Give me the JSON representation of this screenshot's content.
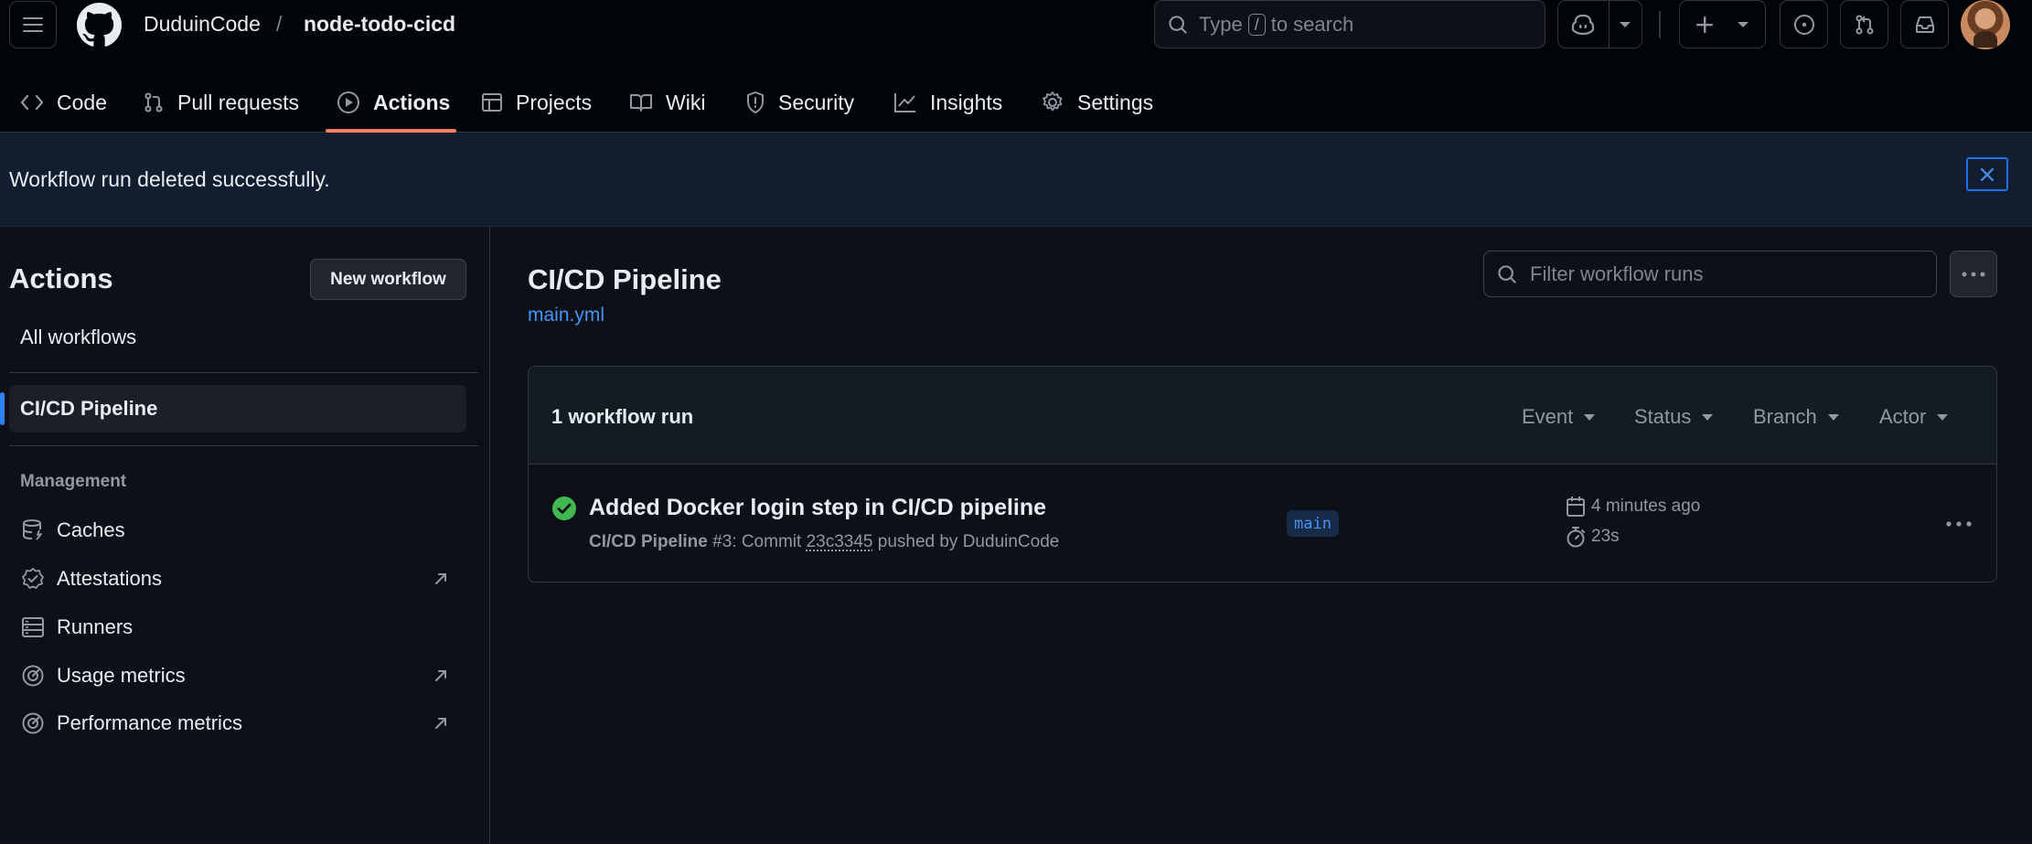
{
  "header": {
    "owner": "DuduinCode",
    "separator": "/",
    "repo": "node-todo-cicd",
    "search_prefix": "Type",
    "search_key": "/",
    "search_suffix": "to search"
  },
  "tabs": [
    {
      "label": "Code",
      "icon": "code-icon"
    },
    {
      "label": "Pull requests",
      "icon": "git-pull-request-icon"
    },
    {
      "label": "Actions",
      "icon": "play-icon",
      "active": true
    },
    {
      "label": "Projects",
      "icon": "table-icon"
    },
    {
      "label": "Wiki",
      "icon": "book-icon"
    },
    {
      "label": "Security",
      "icon": "shield-icon"
    },
    {
      "label": "Insights",
      "icon": "graph-icon"
    },
    {
      "label": "Settings",
      "icon": "gear-icon"
    }
  ],
  "flash": {
    "message": "Workflow run deleted successfully."
  },
  "sidebar": {
    "title": "Actions",
    "new_workflow": "New workflow",
    "all_workflows": "All workflows",
    "selected_workflow": "CI/CD Pipeline",
    "management_heading": "Management",
    "items": [
      {
        "label": "Caches",
        "icon": "database-icon",
        "external": false
      },
      {
        "label": "Attestations",
        "icon": "verified-icon",
        "external": true
      },
      {
        "label": "Runners",
        "icon": "server-icon",
        "external": false
      },
      {
        "label": "Usage metrics",
        "icon": "meter-icon",
        "external": true
      },
      {
        "label": "Performance metrics",
        "icon": "meter-icon",
        "external": true
      }
    ]
  },
  "main": {
    "title": "CI/CD Pipeline",
    "file": "main.yml",
    "filter_placeholder": "Filter workflow runs",
    "runs_count": "1 workflow run",
    "facets": [
      "Event",
      "Status",
      "Branch",
      "Actor"
    ],
    "runs": [
      {
        "title": "Added Docker login step in CI/CD pipeline",
        "workflow": "CI/CD Pipeline",
        "run_number": "#3",
        "commit_prefix": ": Commit",
        "sha": "23c3345",
        "pushed_by": "pushed by DuduinCode",
        "branch": "main",
        "when": "4 minutes ago",
        "duration": "23s",
        "status": "success"
      }
    ]
  },
  "colors": {
    "background": "#0d1117",
    "header": "#010409",
    "accent_underline": "#f78166",
    "link": "#4493f8",
    "success": "#3fb950",
    "flash_bg": "#121d2f"
  }
}
